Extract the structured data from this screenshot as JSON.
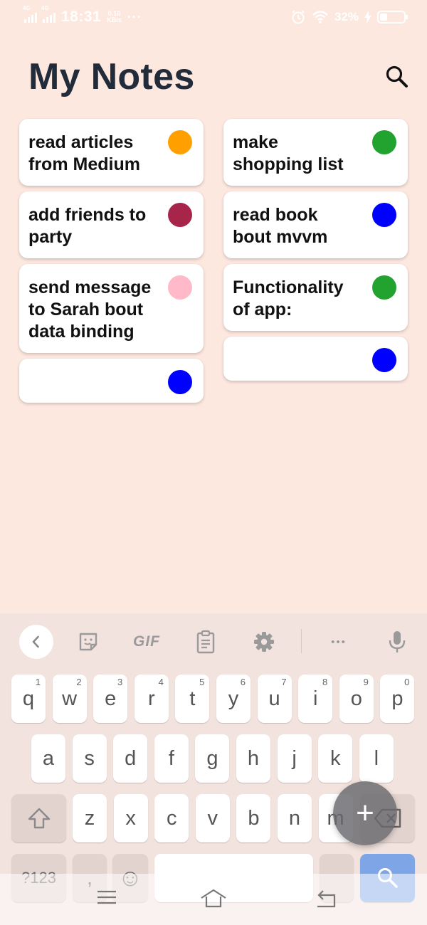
{
  "status_bar": {
    "network_1": "4G",
    "network_2": "4G",
    "time": "18:31",
    "speed_value": "0.10",
    "speed_unit": "KB/s",
    "more": "···",
    "battery_percent": "32%",
    "battery_level": 0.32
  },
  "header": {
    "title": "My Notes",
    "search_icon": "search-icon"
  },
  "notes": {
    "left": [
      {
        "text": "read articles\nfrom Medium",
        "color": "#ffa000"
      },
      {
        "text": "add friends to\nparty",
        "color": "#a8254a"
      },
      {
        "text": "send message\nto Sarah bout\ndata binding",
        "color": "#ffb9c8"
      },
      {
        "text": "",
        "color": "#0000ff"
      }
    ],
    "right": [
      {
        "text": "make\nshopping list",
        "color": "#22a22f"
      },
      {
        "text": "read book\nbout mvvm",
        "color": "#0000ff"
      },
      {
        "text": "Functionality\nof app:",
        "color": "#22a22f"
      },
      {
        "text": "",
        "color": "#0000ff"
      }
    ]
  },
  "fab": {
    "label": "+"
  },
  "keyboard": {
    "toolbar": {
      "back_icon": "chevron-left-icon",
      "sticker_icon": "sticker-icon",
      "gif_label": "GIF",
      "clipboard_icon": "clipboard-icon",
      "settings_icon": "gear-icon",
      "more_label": "•••",
      "mic_icon": "microphone-icon"
    },
    "row1": [
      {
        "key": "q",
        "hint": "1"
      },
      {
        "key": "w",
        "hint": "2"
      },
      {
        "key": "e",
        "hint": "3"
      },
      {
        "key": "r",
        "hint": "4"
      },
      {
        "key": "t",
        "hint": "5"
      },
      {
        "key": "y",
        "hint": "6"
      },
      {
        "key": "u",
        "hint": "7"
      },
      {
        "key": "i",
        "hint": "8"
      },
      {
        "key": "o",
        "hint": "9"
      },
      {
        "key": "p",
        "hint": "0"
      }
    ],
    "row2": [
      "a",
      "s",
      "d",
      "f",
      "g",
      "h",
      "j",
      "k",
      "l"
    ],
    "row3": [
      "z",
      "x",
      "c",
      "v",
      "b",
      "n",
      "m"
    ],
    "shift_icon": "shift-icon",
    "backspace_icon": "backspace-icon",
    "symbols_label": "?123",
    "comma_label": ",",
    "emoji_label": "☺",
    "search_key_icon": "search-icon"
  },
  "nav_bar": {
    "menu_icon": "menu-icon",
    "home_icon": "home-icon",
    "back_icon": "back-icon"
  }
}
